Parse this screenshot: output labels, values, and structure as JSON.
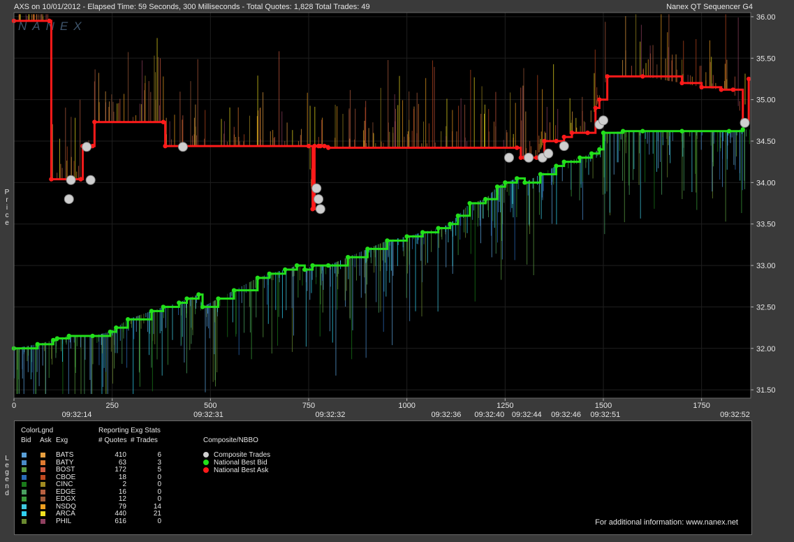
{
  "header": {
    "left_text": "AXS on 10/01/2012  -  Elapsed Time: 59 Seconds, 300 Milliseconds  -  Total Quotes: 1,828  Total Trades: 49",
    "right_text": "Nanex QT Sequencer G4",
    "watermark": "NANEX"
  },
  "side_labels": {
    "price": "Price",
    "legend": "Legend"
  },
  "colors": {
    "background": "#000000",
    "frame": "#3a3a3a",
    "grid": "#1f1f1f",
    "national_best_bid": "#22e01a",
    "national_best_ask": "#ff1a1a",
    "composite_trades": "#cfcfcf"
  },
  "chart_data": {
    "type": "line",
    "title": "AXS on 10/01/2012",
    "ylabel": "Price",
    "ylim": [
      31.4,
      36.05
    ],
    "y_ticks": [
      "31.50",
      "32.00",
      "32.50",
      "33.00",
      "33.50",
      "34.00",
      "34.50",
      "35.00",
      "35.50",
      "36.00"
    ],
    "xlim": [
      0,
      1875
    ],
    "x_ticks": [
      "0",
      "250",
      "500",
      "750",
      "1000",
      "1250",
      "1500",
      "1750"
    ],
    "x_tick_values": [
      0,
      250,
      500,
      750,
      1000,
      1250,
      1500,
      1750
    ],
    "time_labels": [
      {
        "x": 160,
        "label": "09:32:14"
      },
      {
        "x": 495,
        "label": "09:32:31"
      },
      {
        "x": 805,
        "label": "09:32:32"
      },
      {
        "x": 1100,
        "label": "09:32:36"
      },
      {
        "x": 1210,
        "label": "09:32:40"
      },
      {
        "x": 1305,
        "label": "09:32:44"
      },
      {
        "x": 1405,
        "label": "09:32:46"
      },
      {
        "x": 1505,
        "label": "09:32:51"
      },
      {
        "x": 1835,
        "label": "09:32:52"
      }
    ],
    "grid": true,
    "series": [
      {
        "name": "National Best Bid",
        "color": "#22e01a",
        "x": [
          0,
          60,
          100,
          110,
          140,
          200,
          245,
          260,
          290,
          350,
          380,
          420,
          440,
          470,
          480,
          520,
          560,
          620,
          650,
          690,
          720,
          740,
          760,
          800,
          850,
          900,
          950,
          1000,
          1040,
          1080,
          1110,
          1130,
          1160,
          1200,
          1230,
          1250,
          1280,
          1300,
          1340,
          1380,
          1400,
          1440,
          1470,
          1490,
          1500,
          1550,
          1600,
          1700,
          1820,
          1855
        ],
        "y": [
          32.0,
          32.05,
          32.1,
          32.12,
          32.15,
          32.15,
          32.2,
          32.25,
          32.35,
          32.45,
          32.5,
          32.55,
          32.6,
          32.65,
          32.5,
          32.6,
          32.7,
          32.85,
          32.9,
          32.95,
          33.0,
          32.95,
          33.0,
          33.0,
          33.1,
          33.2,
          33.3,
          33.35,
          33.4,
          33.45,
          33.5,
          33.6,
          33.75,
          33.8,
          33.95,
          34.0,
          34.05,
          34.0,
          34.1,
          34.2,
          34.25,
          34.3,
          34.35,
          34.4,
          34.6,
          34.62,
          34.62,
          34.62,
          34.62,
          34.64
        ]
      },
      {
        "name": "National Best Ask",
        "color": "#ff1a1a",
        "x": [
          0,
          90,
          95,
          170,
          175,
          200,
          205,
          380,
          385,
          750,
          760,
          765,
          775,
          780,
          790,
          800,
          1280,
          1290,
          1300,
          1330,
          1350,
          1380,
          1400,
          1420,
          1460,
          1480,
          1490,
          1510,
          1600,
          1700,
          1750,
          1800,
          1830,
          1855,
          1870
        ],
        "y": [
          35.95,
          35.95,
          34.04,
          34.04,
          34.44,
          34.44,
          34.73,
          34.73,
          34.44,
          34.44,
          33.68,
          34.44,
          34.44,
          34.44,
          34.44,
          34.42,
          34.42,
          34.3,
          34.3,
          34.3,
          34.5,
          34.5,
          34.55,
          34.6,
          34.6,
          34.9,
          35.0,
          35.28,
          35.28,
          35.2,
          35.15,
          35.12,
          35.12,
          34.75,
          35.25
        ]
      }
    ],
    "trades": {
      "name": "Composite Trades",
      "x": [
        140,
        145,
        185,
        195,
        430,
        770,
        775,
        780,
        1260,
        1310,
        1345,
        1360,
        1400,
        1490,
        1500,
        1860
      ],
      "y": [
        33.8,
        34.03,
        34.43,
        34.03,
        34.43,
        33.93,
        33.8,
        33.68,
        34.3,
        34.3,
        34.3,
        34.35,
        34.44,
        34.7,
        34.75,
        34.72
      ]
    },
    "legend": {
      "placement": "bottom",
      "color_legend_title": "ColorLgnd",
      "stats_title": "Reporting Exg Stats",
      "col_bid": "Bid",
      "col_ask": "Ask",
      "col_exg": "Exg",
      "col_quotes": "# Quotes",
      "col_trades": "# Trades",
      "nbbo_title": "Composite/NBBO",
      "exchanges": [
        {
          "exg": "BATS",
          "quotes": "410",
          "trades": "6",
          "bid_color": "#5aa0d8",
          "ask_color": "#e8a040"
        },
        {
          "exg": "BATY",
          "quotes": "63",
          "trades": "3",
          "bid_color": "#4a8ac8",
          "ask_color": "#e07a30"
        },
        {
          "exg": "BOST",
          "quotes": "172",
          "trades": "5",
          "bid_color": "#5a9a40",
          "ask_color": "#d05a40"
        },
        {
          "exg": "CBOE",
          "quotes": "18",
          "trades": "0",
          "bid_color": "#2a6ab8",
          "ask_color": "#c04a20"
        },
        {
          "exg": "CINC",
          "quotes": "2",
          "trades": "0",
          "bid_color": "#1a7a1a",
          "ask_color": "#a08a20"
        },
        {
          "exg": "EDGE",
          "quotes": "16",
          "trades": "0",
          "bid_color": "#4aa060",
          "ask_color": "#b86040"
        },
        {
          "exg": "EDGX",
          "quotes": "12",
          "trades": "0",
          "bid_color": "#3a9a3a",
          "ask_color": "#a05a3a"
        },
        {
          "exg": "NSDQ",
          "quotes": "79",
          "trades": "14",
          "bid_color": "#40c8e0",
          "ask_color": "#f0a020"
        },
        {
          "exg": "ARCA",
          "quotes": "440",
          "trades": "21",
          "bid_color": "#30d0f0",
          "ask_color": "#f0e020"
        },
        {
          "exg": "PHIL",
          "quotes": "616",
          "trades": "0",
          "bid_color": "#6a8a30",
          "ask_color": "#904060"
        }
      ],
      "nbbo_items": [
        {
          "label": "Composite Trades",
          "color": "#cfcfcf"
        },
        {
          "label": "National Best Bid",
          "color": "#22e01a"
        },
        {
          "label": "National Best Ask",
          "color": "#ff1a1a"
        }
      ],
      "footer": "For additional information: www.nanex.net"
    }
  }
}
